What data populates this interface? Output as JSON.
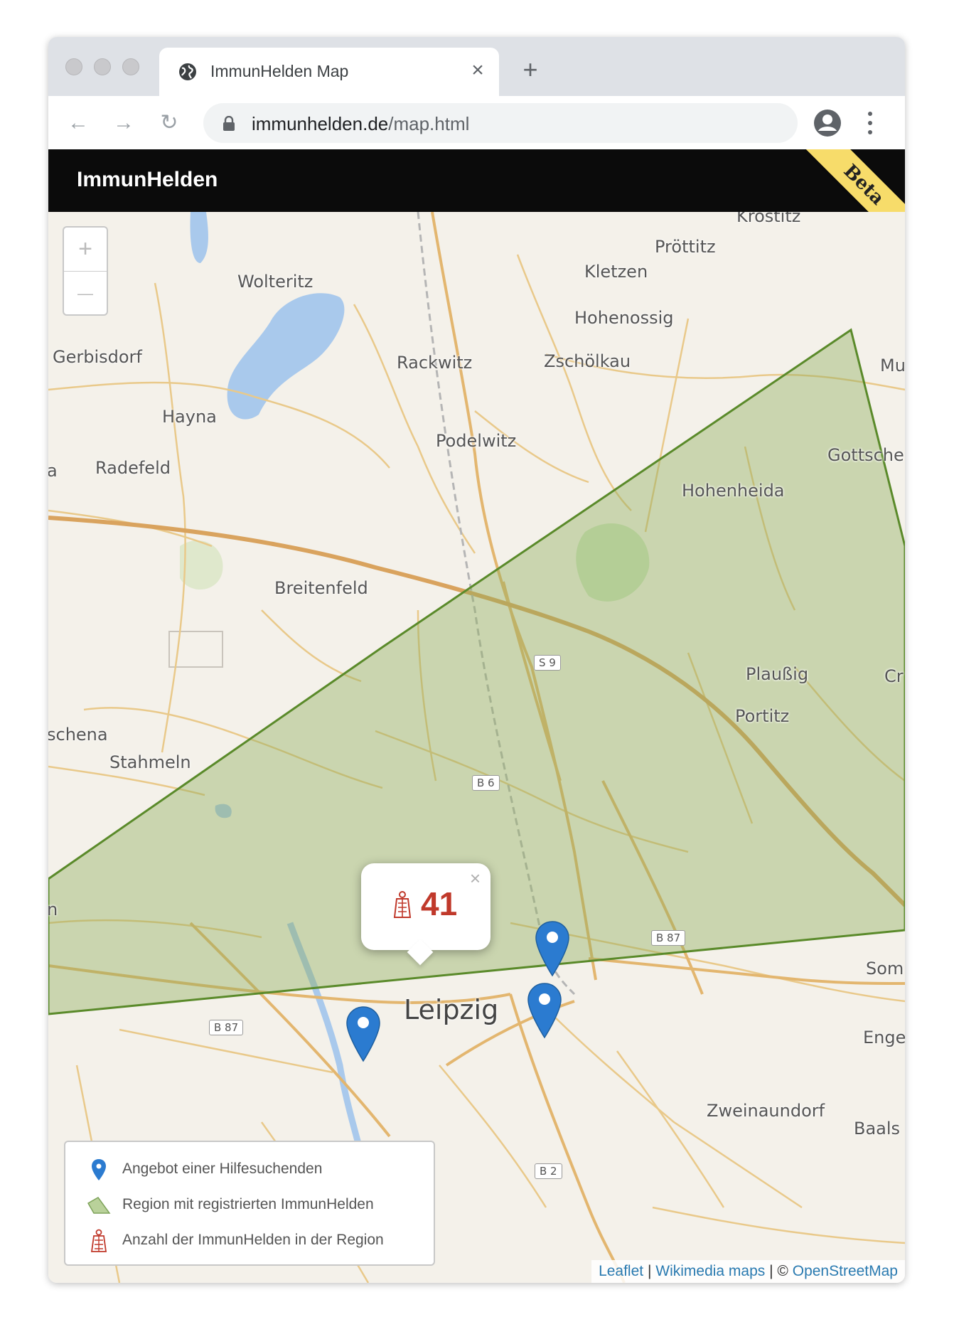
{
  "browser": {
    "tab_title": "ImmunHelden Map",
    "tab_close": "×",
    "new_tab": "+",
    "url_host": "immunhelden.de",
    "url_path": "/map.html"
  },
  "app": {
    "brand": "ImmunHelden",
    "ribbon": "Beta"
  },
  "map": {
    "zoom_in": "+",
    "zoom_out": "—",
    "places": {
      "krostitz": "Krostitz",
      "prottitz": "Pröttitz",
      "kletzen": "Kletzen",
      "wolteritz": "Wolteritz",
      "hohenossig": "Hohenossig",
      "gerbisdorf": "Gerbisdorf",
      "rackwitz": "Rackwitz",
      "zscholkau": "Zschölkau",
      "mu": "Mu",
      "hayna": "Hayna",
      "podelwitz": "Podelwitz",
      "gottsche": "Gottsche",
      "radefeld": "Radefeld",
      "a": "a",
      "hohenheida": "Hohenheida",
      "breitenfeld": "Breitenfeld",
      "plaussig": "Plaußig",
      "cr": "Cr",
      "portitz": "Portitz",
      "schena": "schena",
      "stahmeln": "Stahmeln",
      "n": "n",
      "som": "Som",
      "leipzig": "Leipzig",
      "enge": "Enge",
      "zweinaundorf": "Zweinaundorf",
      "baals": "Baals"
    },
    "shields": {
      "s9": "S 9",
      "b6": "B 6",
      "b87_east": "B 87",
      "b87_west": "B 87",
      "b2": "B 2"
    },
    "popup": {
      "count": "41",
      "close": "×"
    },
    "legend": {
      "offer": "Angebot einer Hilfesuchenden",
      "region": "Region mit registrierten ImmunHelden",
      "count": "Anzahl der ImmunHelden in der Region"
    },
    "attribution": {
      "leaflet": "Leaflet",
      "sep1": " | ",
      "wikimedia": "Wikimedia maps",
      "sep2": " | © ",
      "osm": "OpenStreetMap"
    },
    "colors": {
      "region_fill": "#8fae5c",
      "region_stroke": "#5a8a2a",
      "marker": "#2b7bd0",
      "hero": "#c0392b"
    }
  }
}
